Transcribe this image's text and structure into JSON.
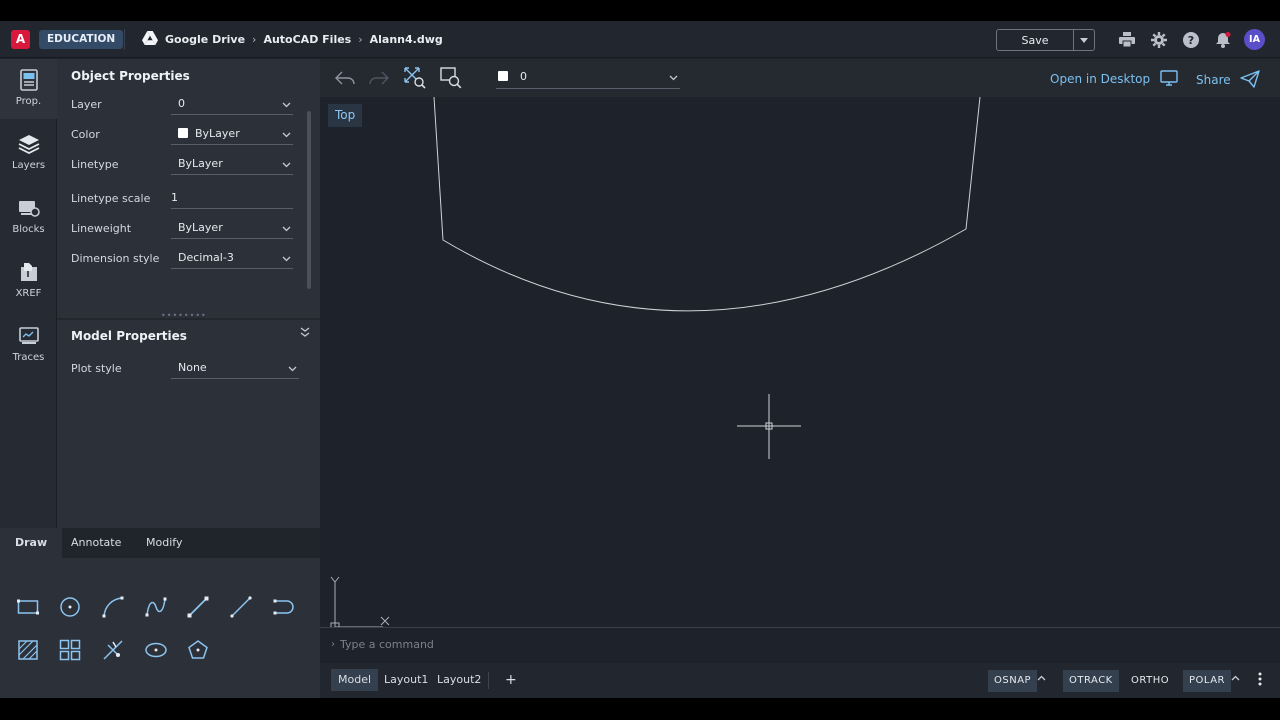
{
  "header": {
    "logo_letter": "A",
    "badge": "EDUCATION",
    "breadcrumbs": [
      "Google Drive",
      "AutoCAD Files",
      "Alann4.dwg"
    ],
    "save_label": "Save",
    "avatar_initials": "IA"
  },
  "rail": {
    "items": [
      {
        "label": "Prop.",
        "icon": "properties-icon"
      },
      {
        "label": "Layers",
        "icon": "layers-icon"
      },
      {
        "label": "Blocks",
        "icon": "blocks-icon"
      },
      {
        "label": "XREF",
        "icon": "xref-icon"
      },
      {
        "label": "Traces",
        "icon": "traces-icon"
      }
    ]
  },
  "object_properties": {
    "title": "Object Properties",
    "rows": [
      {
        "label": "Layer",
        "value": "0"
      },
      {
        "label": "Color",
        "value": "ByLayer"
      },
      {
        "label": "Linetype",
        "value": "ByLayer"
      },
      {
        "label": "Linetype scale",
        "value": "1"
      },
      {
        "label": "Lineweight",
        "value": "ByLayer"
      },
      {
        "label": "Dimension style",
        "value": "Decimal-3"
      }
    ]
  },
  "model_properties": {
    "title": "Model Properties",
    "rows": [
      {
        "label": "Plot style",
        "value": "None"
      }
    ]
  },
  "tools": {
    "tabs": [
      "Draw",
      "Annotate",
      "Modify"
    ],
    "active_tab": "Draw"
  },
  "canvas_toolbar": {
    "layer_value": "0",
    "open_in_desktop": "Open in Desktop",
    "share": "Share"
  },
  "canvas": {
    "view_label": "Top",
    "ucs_x": "X",
    "ucs_y": "Y"
  },
  "command": {
    "placeholder": "Type a command"
  },
  "statusbar": {
    "layouts": [
      "Model",
      "Layout1",
      "Layout2"
    ],
    "add": "+",
    "toggles": [
      "OSNAP",
      "OTRACK",
      "ORTHO",
      "POLAR"
    ]
  },
  "colors": {
    "accent": "#7cc0f0",
    "brand_red": "#d8193c",
    "canvas_bg": "#1e222a"
  }
}
